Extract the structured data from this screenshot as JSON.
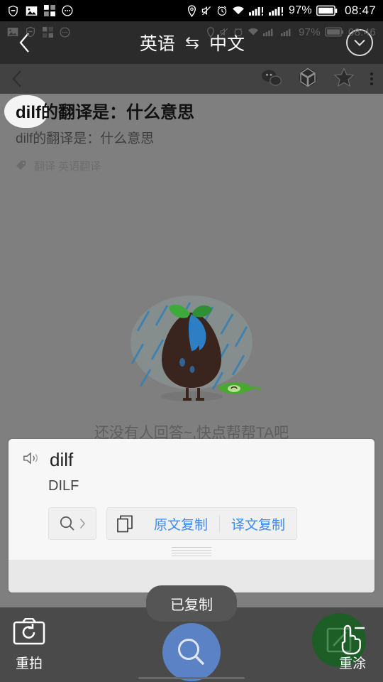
{
  "status_bar": {
    "left_icons": [
      "shield-icon",
      "photo-icon",
      "apps-grid-icon",
      "more-circle-icon"
    ],
    "right_icons": [
      "location-pin-icon",
      "mute-icon",
      "alarm-icon",
      "wifi-icon",
      "signal-sim1-icon",
      "signal-sim2-icon"
    ],
    "battery_percent": "97%",
    "time": "08:47"
  },
  "ghost_status_bar": {
    "battery_percent": "97%",
    "time": "08:46"
  },
  "title_bar": {
    "back_icon": "chevron-left-icon",
    "source_language": "英语",
    "swap_symbol": "⇆",
    "target_language": "中文",
    "collapse_icon": "chevron-down-circle-icon"
  },
  "qa_header": {
    "back_icon": "chevron-left-icon",
    "actions": [
      "comments-icon",
      "camera-aperture-icon",
      "star-icon",
      "overflow-menu-icon"
    ]
  },
  "question": {
    "title": "dilf的翻译是：什么意思",
    "subtitle": "dilf的翻译是：什么意思",
    "tag_icon": "tag-icon",
    "tags": "翻译 英语翻译"
  },
  "empty_state": {
    "illustration": "sad-seed-in-rain-illustration",
    "message": "还没有人回答~,快点帮帮TA吧"
  },
  "translation_card": {
    "speaker_icon": "speaker-icon",
    "word": "dilf",
    "translation": "DILF",
    "search_icon": "search-icon",
    "search_chevron_icon": "chevron-right-icon",
    "copy_icon": "copy-icon",
    "copy_source_label": "原文复制",
    "copy_target_label": "译文复制",
    "accent_color": "#3b8cf5",
    "drag_handle": "drag-handle"
  },
  "toast": {
    "message": "已复制"
  },
  "bottom_bar": {
    "retake_icon": "camera-retake-icon",
    "retake_label": "重拍",
    "search_fab_icon": "search-icon",
    "search_fab_color": "#5b82c4",
    "repaint_icon": "edit-square-icon",
    "repaint_label": "重涂",
    "repaint_fab_color": "#1d5e26",
    "cursor_icon": "pointing-hand-cursor"
  }
}
